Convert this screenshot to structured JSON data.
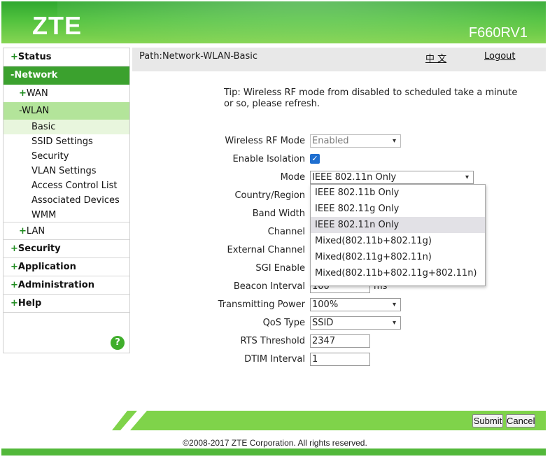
{
  "header": {
    "logo": "ZTE",
    "model": "F660RV1"
  },
  "sidebar": {
    "status": "Status",
    "network": "Network",
    "wan": "WAN",
    "wlan": "WLAN",
    "wlan_items": [
      "Basic",
      "SSID Settings",
      "Security",
      "VLAN Settings",
      "Access Control List",
      "Associated Devices",
      "WMM"
    ],
    "lan": "LAN",
    "security": "Security",
    "application": "Application",
    "administration": "Administration",
    "help": "Help",
    "help_icon": "?"
  },
  "pathbar": {
    "path": "Path:Network-WLAN-Basic",
    "language": "中 文",
    "logout": "Logout"
  },
  "tip": "Tip: Wireless RF mode from disabled to scheduled take a minute or so, please refresh.",
  "form": {
    "wireless_rf_mode": {
      "label": "Wireless RF Mode",
      "value": "Enabled"
    },
    "enable_isolation": {
      "label": "Enable Isolation",
      "checked": true,
      "check_glyph": "✓"
    },
    "mode": {
      "label": "Mode",
      "value": "IEEE 802.11n Only",
      "options": [
        "IEEE 802.11b Only",
        "IEEE 802.11g Only",
        "IEEE 802.11n Only",
        "Mixed(802.11b+802.11g)",
        "Mixed(802.11g+802.11n)",
        "Mixed(802.11b+802.11g+802.11n)"
      ]
    },
    "country_region": {
      "label": "Country/Region"
    },
    "band_width": {
      "label": "Band Width"
    },
    "channel": {
      "label": "Channel"
    },
    "external_channel": {
      "label": "External Channel"
    },
    "sgi_enable": {
      "label": "SGI Enable"
    },
    "beacon_interval": {
      "label": "Beacon Interval",
      "value": "100",
      "unit": "ms"
    },
    "transmitting_power": {
      "label": "Transmitting Power",
      "value": "100%"
    },
    "qos_type": {
      "label": "QoS Type",
      "value": "SSID"
    },
    "rts_threshold": {
      "label": "RTS Threshold",
      "value": "2347"
    },
    "dtim_interval": {
      "label": "DTIM Interval",
      "value": "1"
    }
  },
  "buttons": {
    "submit": "Submit",
    "cancel": "Cancel"
  },
  "footer": {
    "copyright": "©2008-2017 ZTE Corporation. All rights reserved."
  },
  "colors": {
    "brand_green": "#3ba12e",
    "light_green": "#86d553"
  }
}
